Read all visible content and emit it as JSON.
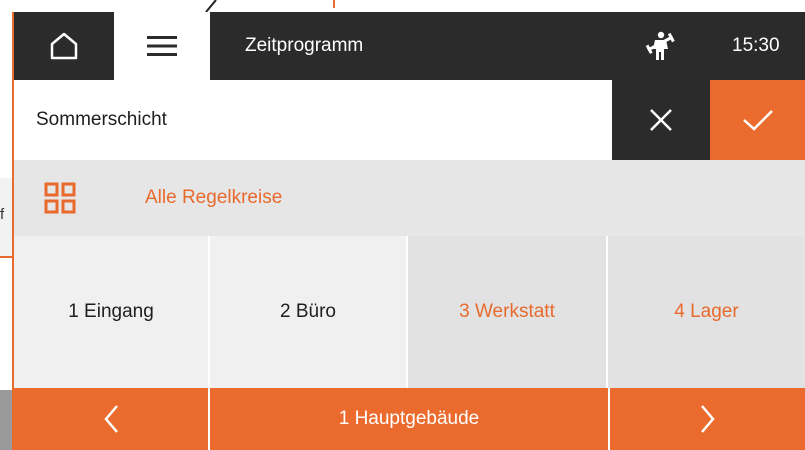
{
  "header": {
    "title": "Zeitprogramm",
    "time": "15:30",
    "icons": [
      "home-icon",
      "menu-icon",
      "craftsman-icon"
    ]
  },
  "program": {
    "name": "Sommerschicht",
    "cancel_icon": "close-icon",
    "confirm_icon": "check-icon"
  },
  "all_circuits": {
    "label": "Alle Regelkreise",
    "icon": "grid-icon"
  },
  "circuits": [
    {
      "label": "1 Eingang",
      "selected": false
    },
    {
      "label": "2 Büro",
      "selected": false
    },
    {
      "label": "3 Werkstatt",
      "selected": true
    },
    {
      "label": "4 Lager",
      "selected": true
    }
  ],
  "footer": {
    "building": "1 Hauptgebäude",
    "prev_icon": "chevron-left-icon",
    "next_icon": "chevron-right-icon"
  },
  "background": {
    "fragment_text": "f"
  },
  "colors": {
    "accent": "#ea6b2d",
    "dark": "#2b2b2b",
    "light_gray": "#f0f0f0",
    "mid_gray": "#e2e2e2"
  }
}
